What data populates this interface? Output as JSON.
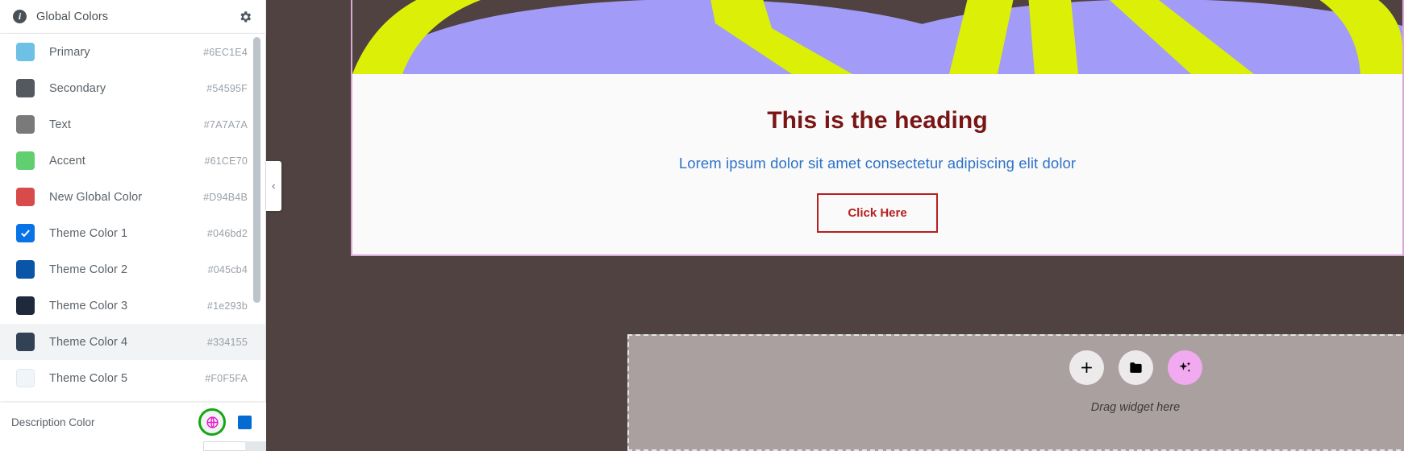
{
  "panel": {
    "header": {
      "title": "Global Colors",
      "info_icon": "info-icon",
      "settings_icon": "gear-icon"
    },
    "colors": [
      {
        "name": "Primary",
        "hex": "#6EC1E4",
        "swatch": "#6ec1e4",
        "selected": false,
        "checked": false,
        "light": false
      },
      {
        "name": "Secondary",
        "hex": "#54595F",
        "swatch": "#54595f",
        "selected": false,
        "checked": false,
        "light": false
      },
      {
        "name": "Text",
        "hex": "#7A7A7A",
        "swatch": "#7a7a7a",
        "selected": false,
        "checked": false,
        "light": false
      },
      {
        "name": "Accent",
        "hex": "#61CE70",
        "swatch": "#61ce70",
        "selected": false,
        "checked": false,
        "light": false
      },
      {
        "name": "New Global Color",
        "hex": "#D94B4B",
        "swatch": "#d94b4b",
        "selected": false,
        "checked": false,
        "light": false
      },
      {
        "name": "Theme Color 1",
        "hex": "#046bd2",
        "swatch": "#0673e6",
        "selected": false,
        "checked": true,
        "light": false
      },
      {
        "name": "Theme Color 2",
        "hex": "#045cb4",
        "swatch": "#0a55a8",
        "selected": false,
        "checked": false,
        "light": false
      },
      {
        "name": "Theme Color 3",
        "hex": "#1e293b",
        "swatch": "#1e293b",
        "selected": false,
        "checked": false,
        "light": false
      },
      {
        "name": "Theme Color 4",
        "hex": "#334155",
        "swatch": "#334155",
        "selected": true,
        "checked": false,
        "light": false
      },
      {
        "name": "Theme Color 5",
        "hex": "#F0F5FA",
        "swatch": "#f0f5fa",
        "selected": false,
        "checked": false,
        "light": true
      }
    ],
    "description_color": {
      "label": "Description Color",
      "globe_icon": "globe-icon",
      "globe_color": "#e818c9",
      "highlight_ring_color": "#16a614",
      "chip_color": "#046bd2"
    },
    "collapse_handle_icon": "chevron-left-icon"
  },
  "canvas": {
    "background_color": "#4f4241",
    "hero": {
      "heading": "This is the heading",
      "heading_color": "#7a1515",
      "subheading": "Lorem ipsum dolor sit amet consectetur adipiscing elit dolor",
      "subheading_color": "#2f72c8",
      "button_label": "Click Here",
      "button_color": "#b51f1f",
      "art_background": "#4f4241",
      "art_shape_color": "#a29bf7",
      "art_line_color": "#dcf007",
      "border_color": "#d9a8d9"
    },
    "dropzone": {
      "label": "Drag widget here",
      "background_color": "#aaa09f",
      "buttons": [
        {
          "name": "add-widget-button",
          "icon": "plus-icon"
        },
        {
          "name": "folder-button",
          "icon": "folder-icon"
        },
        {
          "name": "ai-generate-button",
          "icon": "sparkle-icon"
        }
      ]
    }
  }
}
